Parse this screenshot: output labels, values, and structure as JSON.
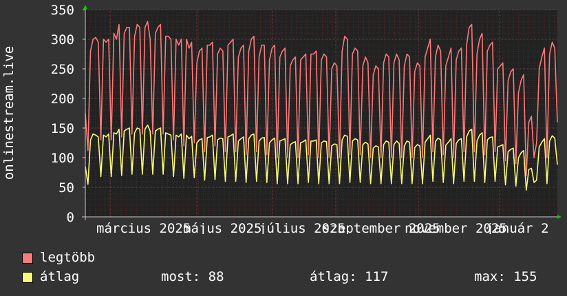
{
  "chart_data": {
    "type": "line",
    "ylabel": "onlinestream.live",
    "ylim": [
      0,
      350
    ],
    "yticks": [
      "0",
      "50",
      "100",
      "150",
      "200",
      "250",
      "300",
      "350"
    ],
    "xtick_labels": [
      "március 2025",
      "május 2025",
      "július 2025",
      "szeptember 2025",
      "november 2025",
      "január 2"
    ],
    "grid": true,
    "series": [
      {
        "name": "legtöbb",
        "color": "#f87b7b",
        "values": [
          175,
          112,
          280,
          300,
          303,
          295,
          130,
          300,
          295,
          300,
          130,
          310,
          300,
          325,
          135,
          310,
          320,
          320,
          140,
          305,
          325,
          320,
          140,
          320,
          330,
          300,
          140,
          310,
          320,
          325,
          140,
          305,
          305,
          300,
          130,
          300,
          290,
          300,
          120,
          300,
          285,
          295,
          125,
          260,
          280,
          285,
          110,
          290,
          290,
          295,
          120,
          275,
          285,
          280,
          110,
          290,
          295,
          300,
          110,
          270,
          285,
          290,
          105,
          280,
          300,
          305,
          110,
          270,
          290,
          290,
          105,
          265,
          285,
          290,
          100,
          270,
          280,
          285,
          100,
          255,
          265,
          270,
          100,
          265,
          270,
          275,
          105,
          275,
          275,
          280,
          100,
          265,
          275,
          270,
          100,
          250,
          260,
          255,
          100,
          280,
          305,
          300,
          105,
          275,
          285,
          280,
          105,
          255,
          270,
          260,
          100,
          240,
          255,
          250,
          100,
          260,
          275,
          270,
          100,
          260,
          275,
          265,
          100,
          255,
          275,
          270,
          100,
          245,
          260,
          255,
          100,
          270,
          285,
          300,
          110,
          270,
          290,
          280,
          105,
          255,
          270,
          285,
          100,
          265,
          280,
          285,
          110,
          290,
          320,
          325,
          110,
          275,
          300,
          310,
          105,
          280,
          290,
          295,
          110,
          250,
          255,
          260,
          95,
          230,
          245,
          250,
          90,
          210,
          230,
          240,
          70,
          160,
          170,
          100,
          125,
          250,
          270,
          285,
          100,
          275,
          295,
          285,
          160
        ]
      },
      {
        "name": "átlag",
        "color": "#f8f87b",
        "values": [
          85,
          55,
          130,
          140,
          138,
          135,
          68,
          138,
          135,
          140,
          68,
          142,
          140,
          148,
          70,
          145,
          148,
          150,
          72,
          142,
          150,
          148,
          72,
          148,
          155,
          145,
          72,
          145,
          148,
          150,
          72,
          142,
          140,
          138,
          68,
          138,
          135,
          140,
          65,
          138,
          132,
          136,
          66,
          125,
          130,
          132,
          62,
          134,
          135,
          138,
          63,
          130,
          133,
          132,
          60,
          135,
          137,
          140,
          60,
          128,
          132,
          135,
          58,
          132,
          138,
          140,
          60,
          128,
          133,
          134,
          58,
          125,
          130,
          133,
          56,
          128,
          130,
          132,
          56,
          122,
          125,
          127,
          56,
          125,
          127,
          130,
          58,
          128,
          128,
          130,
          56,
          125,
          128,
          127,
          56,
          120,
          123,
          122,
          56,
          130,
          138,
          136,
          58,
          128,
          132,
          130,
          58,
          122,
          126,
          123,
          56,
          116,
          120,
          118,
          56,
          122,
          128,
          126,
          56,
          122,
          128,
          124,
          56,
          120,
          128,
          126,
          56,
          117,
          122,
          120,
          56,
          126,
          132,
          138,
          60,
          127,
          133,
          130,
          58,
          121,
          126,
          132,
          56,
          124,
          130,
          132,
          60,
          135,
          145,
          148,
          60,
          128,
          138,
          142,
          58,
          130,
          134,
          135,
          60,
          118,
          120,
          122,
          54,
          110,
          114,
          116,
          52,
          100,
          108,
          112,
          45,
          80,
          82,
          58,
          62,
          118,
          126,
          132,
          56,
          128,
          137,
          133,
          88
        ]
      }
    ]
  },
  "legend": {
    "items": [
      {
        "label": "legtöbb",
        "color": "#f87b7b"
      },
      {
        "label": "átlag",
        "color": "#f8f87b"
      }
    ],
    "stats": {
      "most": "most: 88",
      "atlag": "átlag: 117",
      "max": "max: 155"
    }
  }
}
